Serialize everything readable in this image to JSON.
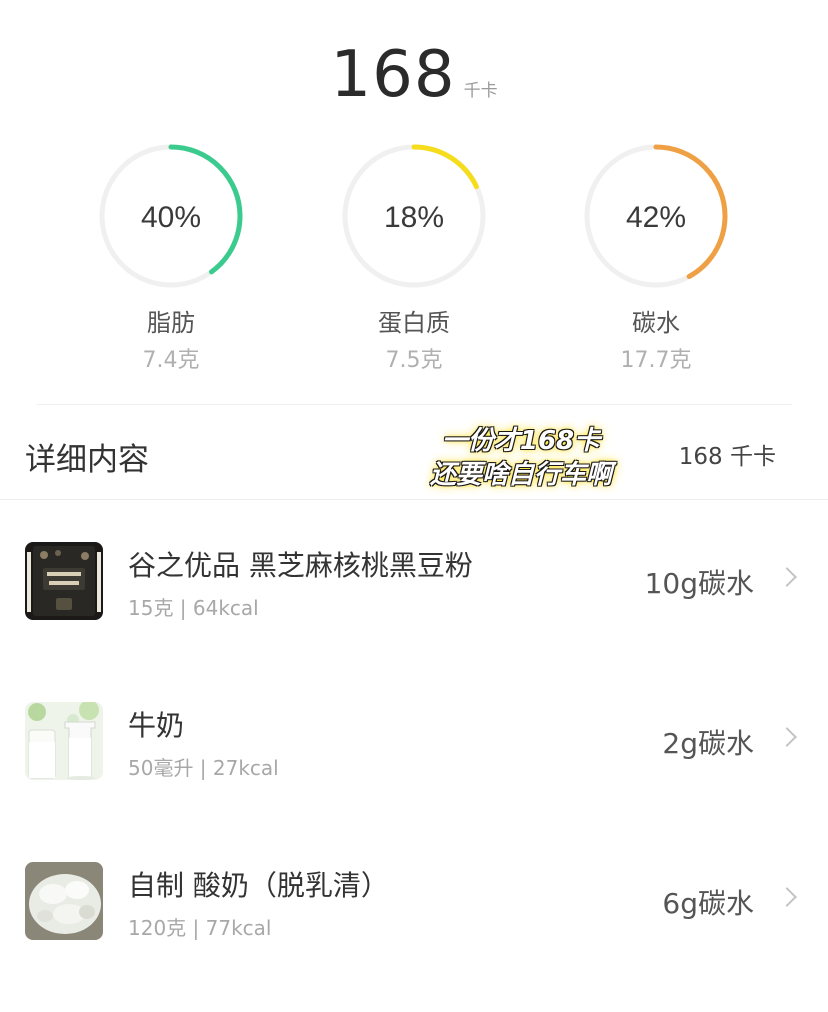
{
  "summary": {
    "total_value": "168",
    "total_unit": "千卡"
  },
  "macros": [
    {
      "name": "脂肪",
      "amount": "7.4克",
      "percent_label": "40%",
      "fraction": 0.4,
      "color": "#3ccb8f"
    },
    {
      "name": "蛋白质",
      "amount": "7.5克",
      "percent_label": "18%",
      "fraction": 0.18,
      "color": "#f5dd1d"
    },
    {
      "name": "碳水",
      "amount": "17.7克",
      "percent_label": "42%",
      "fraction": 0.42,
      "color": "#f0a044"
    }
  ],
  "details": {
    "title": "详细内容",
    "total": "168 千卡",
    "overlay_line1": "一份才168卡",
    "overlay_line2": "还要啥自行车啊"
  },
  "foods": [
    {
      "name": "谷之优品 黑芝麻核桃黑豆粉",
      "sub": "15克 | 64kcal",
      "carb": "10g碳水",
      "thumb_icon": "black-sesame-powder-package-icon"
    },
    {
      "name": "牛奶",
      "sub": "50毫升 | 27kcal",
      "carb": "2g碳水",
      "thumb_icon": "milk-glasses-icon"
    },
    {
      "name": "自制 酸奶（脱乳清）",
      "sub": "120克 | 77kcal",
      "carb": "6g碳水",
      "thumb_icon": "strained-yogurt-icon"
    }
  ]
}
